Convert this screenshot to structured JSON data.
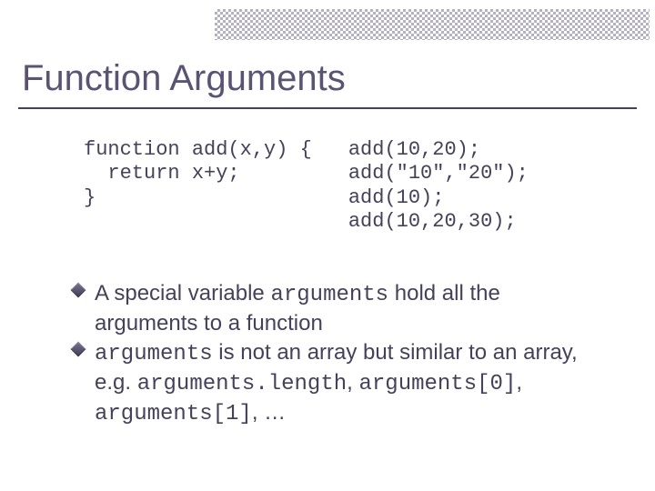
{
  "title": "Function Arguments",
  "code": {
    "left": "function add(x,y) {\n  return x+y;\n}",
    "right": "add(10,20);\nadd(\"10\",\"20\");\nadd(10);\nadd(10,20,30);"
  },
  "bullets": {
    "b1": {
      "p1": "A special variable ",
      "c1": "arguments",
      "p2": " hold all the arguments to a function"
    },
    "b2": {
      "c1": "arguments",
      "p1": " is not an array but similar to an array, e.g. ",
      "c2": "arguments.length",
      "p2": ", ",
      "c3": "arguments[0]",
      "p3": ", ",
      "c4": "arguments[1]",
      "p4": ", …"
    }
  }
}
